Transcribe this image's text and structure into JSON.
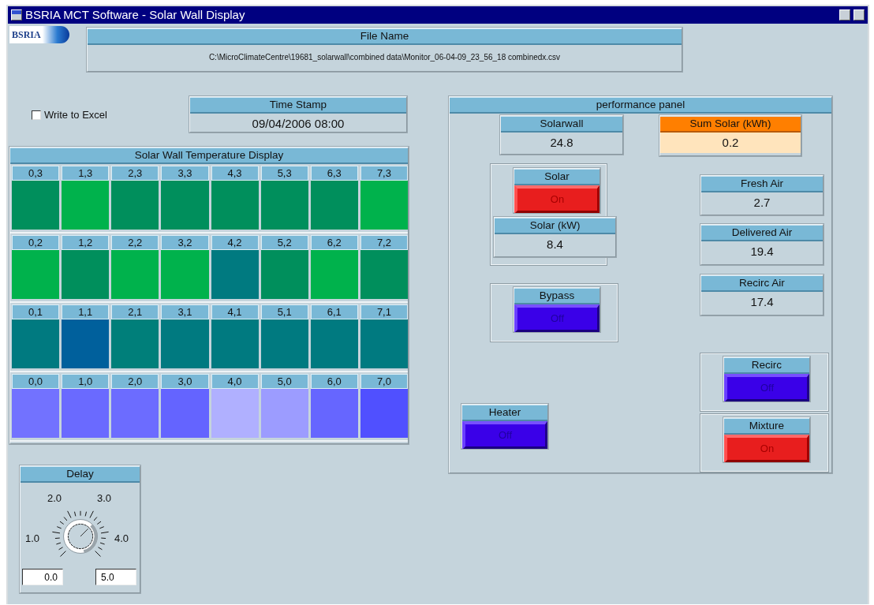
{
  "window": {
    "title": "BSRIA MCT Software - Solar Wall Display"
  },
  "logo": {
    "text": "BSRIA"
  },
  "file_name": {
    "label": "File Name",
    "value": "C:\\MicroClimateCentre\\19681_solarwall\\combined data\\Monitor_06-04-09_23_56_18 combinedx.csv"
  },
  "write_to_excel": {
    "label": "Write to Excel",
    "checked": false
  },
  "time_stamp": {
    "label": "Time Stamp",
    "value": "09/04/2006 08:00"
  },
  "temperature_display": {
    "title": "Solar Wall Temperature Display",
    "rows": [
      [
        {
          "label": "0,3",
          "color": "#008f5c"
        },
        {
          "label": "1,3",
          "color": "#00b24c"
        },
        {
          "label": "2,3",
          "color": "#008f5c"
        },
        {
          "label": "3,3",
          "color": "#008f5c"
        },
        {
          "label": "4,3",
          "color": "#008f5c"
        },
        {
          "label": "5,3",
          "color": "#008f5c"
        },
        {
          "label": "6,3",
          "color": "#008f5c"
        },
        {
          "label": "7,3",
          "color": "#00b24c"
        }
      ],
      [
        {
          "label": "0,2",
          "color": "#00b24c"
        },
        {
          "label": "1,2",
          "color": "#008f5c"
        },
        {
          "label": "2,2",
          "color": "#00b24c"
        },
        {
          "label": "3,2",
          "color": "#00b24c"
        },
        {
          "label": "4,2",
          "color": "#007a80"
        },
        {
          "label": "5,2",
          "color": "#008f5c"
        },
        {
          "label": "6,2",
          "color": "#00b24c"
        },
        {
          "label": "7,2",
          "color": "#008f5c"
        }
      ],
      [
        {
          "label": "0,1",
          "color": "#007a80"
        },
        {
          "label": "1,1",
          "color": "#00609c"
        },
        {
          "label": "2,1",
          "color": "#007f7a"
        },
        {
          "label": "3,1",
          "color": "#007a80"
        },
        {
          "label": "4,1",
          "color": "#007a80"
        },
        {
          "label": "5,1",
          "color": "#007a80"
        },
        {
          "label": "6,1",
          "color": "#007a80"
        },
        {
          "label": "7,1",
          "color": "#007a80"
        }
      ],
      [
        {
          "label": "0,0",
          "color": "#7272ff"
        },
        {
          "label": "1,0",
          "color": "#6a6aff"
        },
        {
          "label": "2,0",
          "color": "#6c6cff"
        },
        {
          "label": "3,0",
          "color": "#6464ff"
        },
        {
          "label": "4,0",
          "color": "#b0b0ff"
        },
        {
          "label": "5,0",
          "color": "#9c9cff"
        },
        {
          "label": "6,0",
          "color": "#6666ff"
        },
        {
          "label": "7,0",
          "color": "#5050ff"
        }
      ]
    ]
  },
  "delay": {
    "label": "Delay",
    "scale_labels": [
      "1.0",
      "2.0",
      "3.0",
      "4.0"
    ],
    "min": "0.0",
    "max": "5.0"
  },
  "performance_panel": {
    "title": "performance panel",
    "indicators": [
      {
        "label": "Solarwall",
        "value": "24.8",
        "kind": "plain"
      },
      {
        "label": "Sum Solar (kWh)",
        "value": "0.2",
        "kind": "highlight"
      },
      {
        "label": "Solar (kW)",
        "value": "8.4",
        "kind": "plain"
      },
      {
        "label": "Fresh Air",
        "value": "2.7",
        "kind": "plain"
      },
      {
        "label": "Delivered Air",
        "value": "19.4",
        "kind": "plain"
      },
      {
        "label": "Recirc Air",
        "value": "17.4",
        "kind": "plain"
      }
    ],
    "switches": [
      {
        "label": "Solar",
        "state": "On",
        "on": true
      },
      {
        "label": "Bypass",
        "state": "Off",
        "on": false
      },
      {
        "label": "Recirc",
        "state": "Off",
        "on": false
      },
      {
        "label": "Heater",
        "state": "Off",
        "on": false
      },
      {
        "label": "Mixture",
        "state": "On",
        "on": true
      }
    ]
  }
}
